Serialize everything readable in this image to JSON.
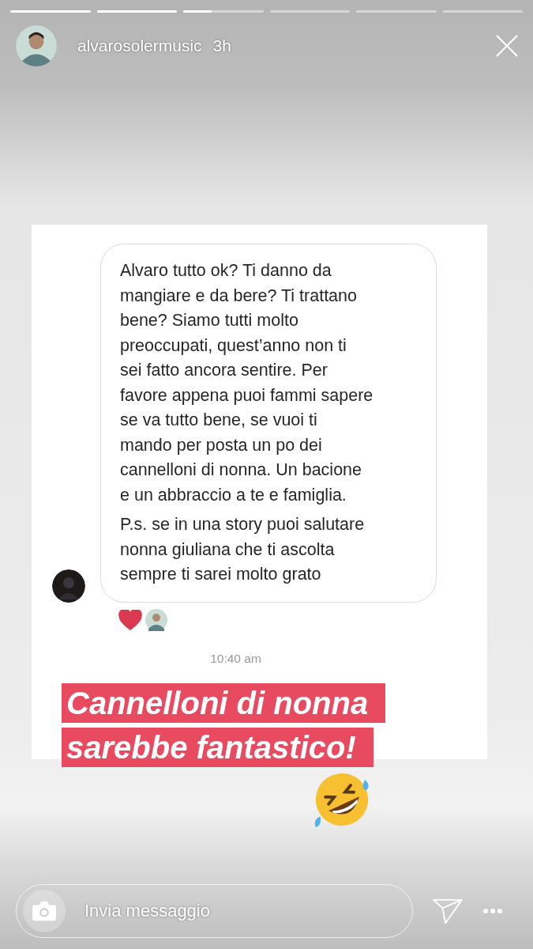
{
  "progress": [
    {
      "level": 1
    },
    {
      "level": 1
    },
    {
      "level": 0.35
    },
    {
      "level": 0
    },
    {
      "level": 0
    },
    {
      "level": 0
    }
  ],
  "header": {
    "username": "alvarosolermusic",
    "time": "3h"
  },
  "message": {
    "paragraphs": [
      [
        "Alvaro tutto ok? Ti danno da",
        "mangiare e da bere? Ti trattano",
        "bene? Siamo tutti molto",
        "preoccupati, quest’anno non ti",
        "sei fatto ancora sentire. Per",
        "favore appena puoi fammi sapere",
        "se va tutto bene, se vuoi ti",
        "mando per posta un po dei",
        "cannelloni di nonna. Un bacione",
        "e un abbraccio a te e famiglia."
      ],
      [
        "P.s. se in una story puoi salutare",
        "nonna giuliana che ti ascolta",
        "sempre ti sarei molto grato"
      ]
    ],
    "liked": true
  },
  "timestamp": "10:40 am",
  "sticker": {
    "lines": [
      "Cannelloni di nonna",
      "sarebbe fantastico!"
    ]
  },
  "reply_bar": {
    "placeholder": "Invia messaggio"
  }
}
